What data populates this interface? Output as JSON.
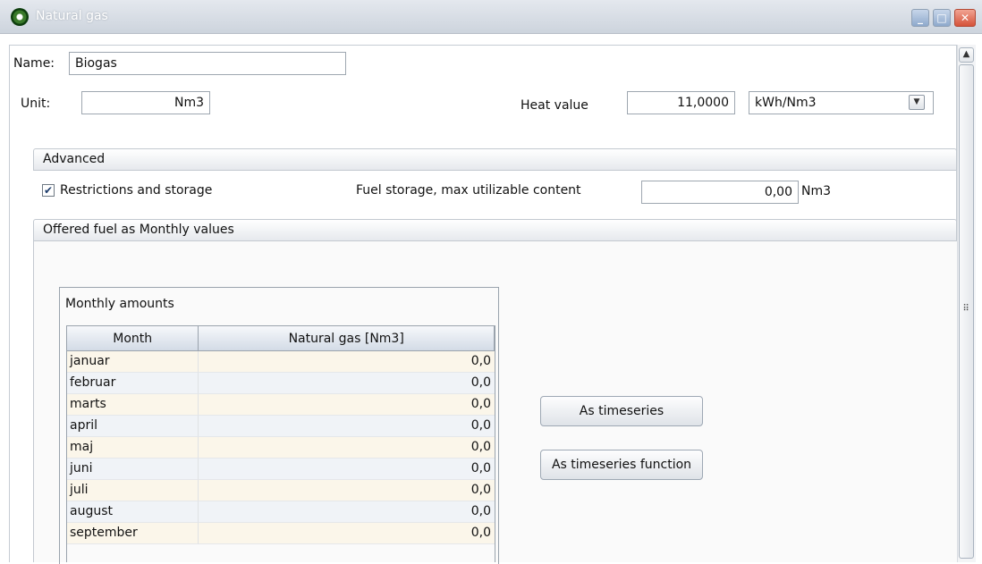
{
  "window": {
    "title": "Natural gas",
    "minimize_icon": "minimize-icon",
    "maximize_icon": "maximize-icon",
    "close_icon": "close-icon"
  },
  "name_field": {
    "label": "Name:",
    "value": "Biogas"
  },
  "unit_field": {
    "label": "Unit:",
    "value": "Nm3"
  },
  "heat_value": {
    "label": "Heat value",
    "value": "11,0000",
    "unit": "kWh/Nm3"
  },
  "advanced": {
    "section_title": "Advanced",
    "restrictions_label": "Restrictions and storage",
    "restrictions_checked": true,
    "fuel_storage_label": "Fuel storage, max utilizable content",
    "fuel_storage_value": "0,00",
    "fuel_storage_unit": "Nm3"
  },
  "offered": {
    "section_title": "Offered fuel as Monthly values",
    "group_title": "Monthly amounts",
    "columns": [
      "Month",
      "Natural gas [Nm3]"
    ],
    "rows": [
      {
        "month": "januar",
        "value": "0,0"
      },
      {
        "month": "februar",
        "value": "0,0"
      },
      {
        "month": "marts",
        "value": "0,0"
      },
      {
        "month": "april",
        "value": "0,0"
      },
      {
        "month": "maj",
        "value": "0,0"
      },
      {
        "month": "juni",
        "value": "0,0"
      },
      {
        "month": "juli",
        "value": "0,0"
      },
      {
        "month": "august",
        "value": "0,0"
      },
      {
        "month": "september",
        "value": "0,0"
      }
    ]
  },
  "buttons": {
    "as_timeseries": "As timeseries",
    "as_timeseries_function": "As timeseries function"
  }
}
